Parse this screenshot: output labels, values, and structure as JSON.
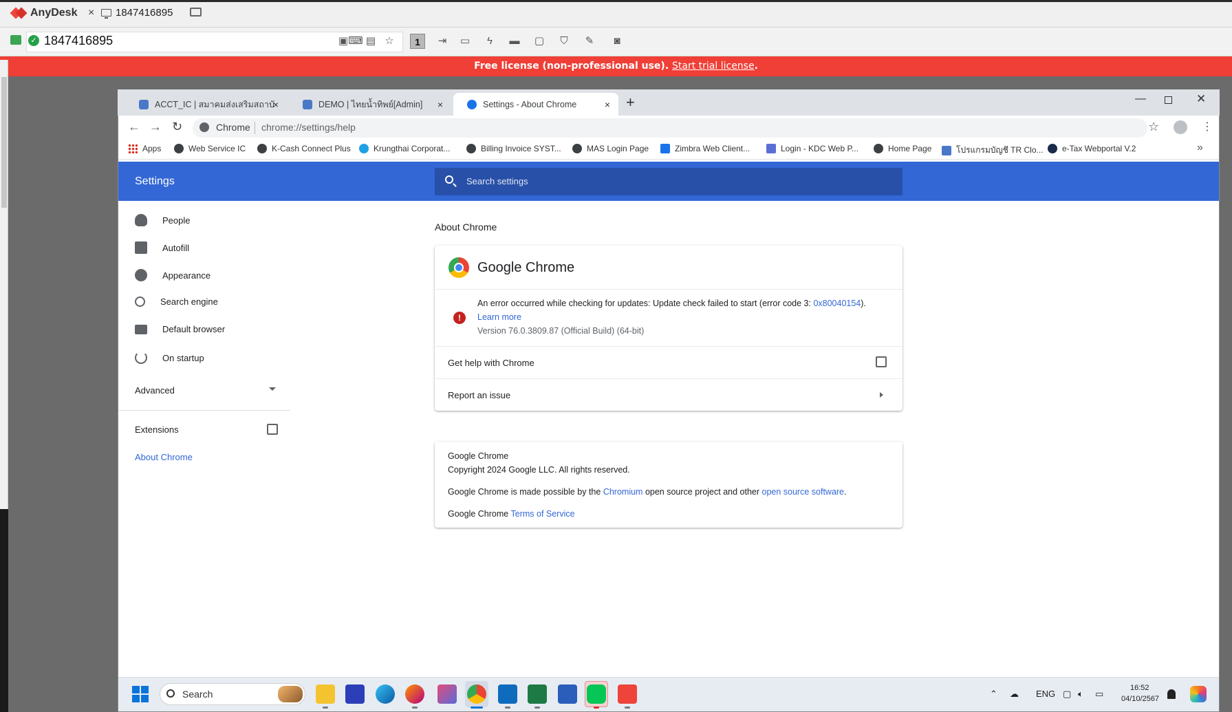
{
  "anydesk": {
    "app_name": "AnyDesk",
    "session_tab": "1847416895",
    "address_value": "1847416895",
    "toolbar_monitor_number": "1",
    "banner_text": "Free license (non-professional use).",
    "banner_link": "Start trial license",
    "banner_period": "."
  },
  "chrome": {
    "tabs": [
      {
        "title": "ACCT_IC | สมาคมส่งเสริมสถาบันนักลงทุน[Su",
        "close": "×"
      },
      {
        "title": "DEMO | ไทยน้ำทิพย์[Admin]",
        "close": "×"
      },
      {
        "title": "Settings - About Chrome",
        "close": "×"
      }
    ],
    "new_tab": "+",
    "omnibox": {
      "site": "Chrome",
      "url": "chrome://settings/help"
    },
    "bookmarks": [
      "Apps",
      "Web Service IC",
      "K-Cash Connect Plus",
      "Krungthai Corporat...",
      "Billing Invoice SYST...",
      "MAS Login Page",
      "Zimbra Web Client...",
      "Login - KDC Web P...",
      "Home Page",
      "โปรแกรมบัญชี TR Clo...",
      "e-Tax Webportal V.2"
    ],
    "bookmarks_more": "»"
  },
  "settings": {
    "title": "Settings",
    "search_placeholder": "Search settings",
    "sidebar": {
      "items": [
        {
          "label": "People",
          "icon": "person-icon"
        },
        {
          "label": "Autofill",
          "icon": "clipboard-icon"
        },
        {
          "label": "Appearance",
          "icon": "palette-icon"
        },
        {
          "label": "Search engine",
          "icon": "search-icon"
        },
        {
          "label": "Default browser",
          "icon": "browser-icon"
        },
        {
          "label": "On startup",
          "icon": "power-icon"
        }
      ],
      "advanced": "Advanced",
      "extensions": "Extensions",
      "about": "About Chrome"
    },
    "about": {
      "heading": "About Chrome",
      "product": "Google Chrome",
      "error_prefix": "An error occurred while checking for updates: Update check failed to start (error code 3: ",
      "error_code": "0x80040154",
      "error_suffix": ").",
      "learn_more": "Learn more",
      "version": "Version 76.0.3809.87 (Official Build) (64-bit)",
      "get_help": "Get help with Chrome",
      "report_issue": "Report an issue"
    },
    "legal": {
      "line1": "Google Chrome",
      "line2": "Copyright 2024 Google LLC. All rights reserved.",
      "line3_a": "Google Chrome is made possible by the ",
      "line3_link1": "Chromium",
      "line3_b": " open source project and other ",
      "line3_link2": "open source software",
      "line3_c": ".",
      "line4_a": "Google Chrome ",
      "line4_link": "Terms of Service"
    }
  },
  "taskbar": {
    "search_label": "Search",
    "language": "ENG",
    "time": "16:52",
    "date": "04/10/2567"
  }
}
